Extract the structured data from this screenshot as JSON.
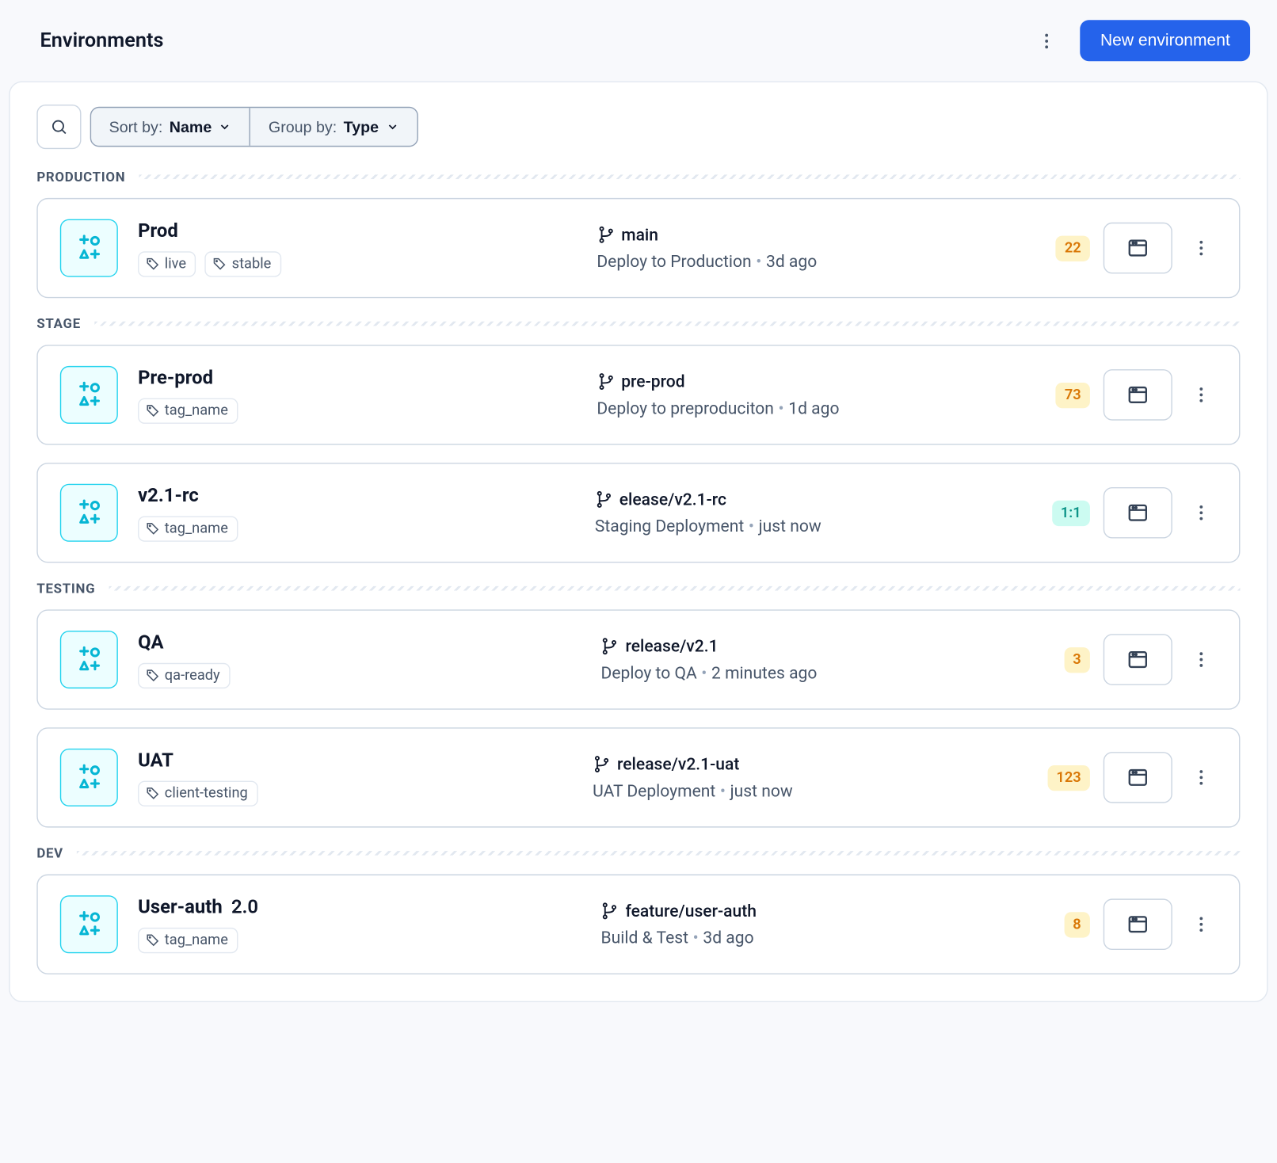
{
  "header": {
    "title": "Environments",
    "new_btn": "New environment"
  },
  "toolbar": {
    "sort_label": "Sort by:",
    "sort_value": "Name",
    "group_label": "Group by:",
    "group_value": "Type"
  },
  "groups": [
    {
      "label": "PRODUCTION",
      "items": [
        {
          "name": "Prod",
          "version": "",
          "tags": [
            "live",
            "stable"
          ],
          "branch": "main",
          "deploy_text": "Deploy to Production",
          "deploy_time": "3d ago",
          "badge_value": "22",
          "badge_color": "orange"
        }
      ]
    },
    {
      "label": "STAGE",
      "items": [
        {
          "name": "Pre-prod",
          "version": "",
          "tags": [
            "tag_name"
          ],
          "branch": "pre-prod",
          "deploy_text": "Deploy to preproduciton",
          "deploy_time": "1d ago",
          "badge_value": "73",
          "badge_color": "orange"
        },
        {
          "name": "v2.1-rc",
          "version": "",
          "tags": [
            "tag_name"
          ],
          "branch": "elease/v2.1-rc",
          "deploy_text": "Staging Deployment",
          "deploy_time": "just now",
          "badge_value": "1:1",
          "badge_color": "teal"
        }
      ]
    },
    {
      "label": "TESTING",
      "items": [
        {
          "name": "QA",
          "version": "",
          "tags": [
            "qa-ready"
          ],
          "branch": "release/v2.1",
          "deploy_text": "Deploy to QA",
          "deploy_time": "2 minutes ago",
          "badge_value": "3",
          "badge_color": "orange"
        },
        {
          "name": "UAT",
          "version": "",
          "tags": [
            "client-testing"
          ],
          "branch": "release/v2.1-uat",
          "deploy_text": "UAT Deployment",
          "deploy_time": "just now",
          "badge_value": "123",
          "badge_color": "orange"
        }
      ]
    },
    {
      "label": "DEV",
      "items": [
        {
          "name": "User-auth",
          "version": "2.0",
          "tags": [
            "tag_name"
          ],
          "branch": "feature/user-auth",
          "deploy_text": "Build & Test",
          "deploy_time": "3d ago",
          "badge_value": "8",
          "badge_color": "orange"
        }
      ]
    }
  ]
}
